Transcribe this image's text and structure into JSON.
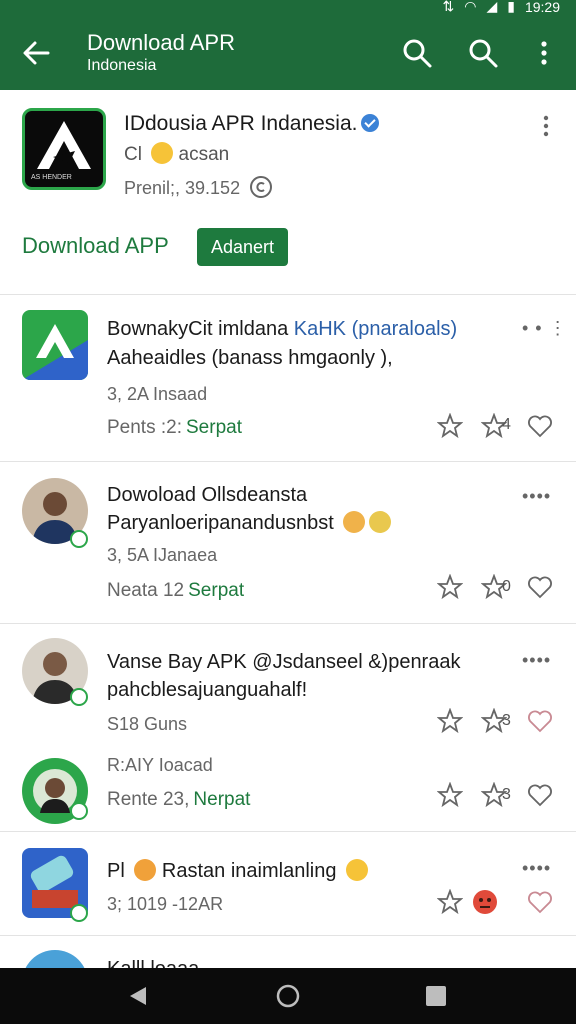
{
  "status": {
    "time": "19:29"
  },
  "appbar": {
    "title": "Download APR",
    "subtitle": "Indonesia"
  },
  "header": {
    "title": "IDdousia APR Indanesia.",
    "sub1_prefix": "Cl",
    "sub1_suffix": "acsan",
    "sub2": "Prenil;, 39.152",
    "logo_badge": "AS HENDER",
    "download_link": "Download APP",
    "download_button": "Adanert"
  },
  "items": [
    {
      "line1": "BownakyCit imldana",
      "line1_blue": "KaHK (pnaraloals)",
      "line2": "Aaheaidles (banass hmgaonly ),",
      "meta": "3, 2A Insaad",
      "stat_label": "Pents :2:",
      "stat_link": "Serpat",
      "count": "4"
    },
    {
      "line1": "Dowoload Ollsdeansta",
      "line2": "Paryanloeripanandusnbst",
      "meta": "3, 5A IJanaea",
      "stat_label": "Neata 12",
      "stat_link": "Serpat",
      "count": "0"
    },
    {
      "line1": "Vanse Bay APK @Jsdanseel &)penraak",
      "line2": "pahcblesajuanguahalf!",
      "meta": "S18 Guns",
      "count": "3"
    },
    {
      "meta": "R:AIY Ioacad",
      "stat_label": "Rente 23,",
      "stat_link": "Nerpat",
      "count": "3"
    },
    {
      "line1_prefix": "Pl",
      "line1": "Rastan inaimlanling",
      "meta": "3; 1019 -12AR"
    },
    {
      "line1": "Kalll loaaa"
    }
  ]
}
